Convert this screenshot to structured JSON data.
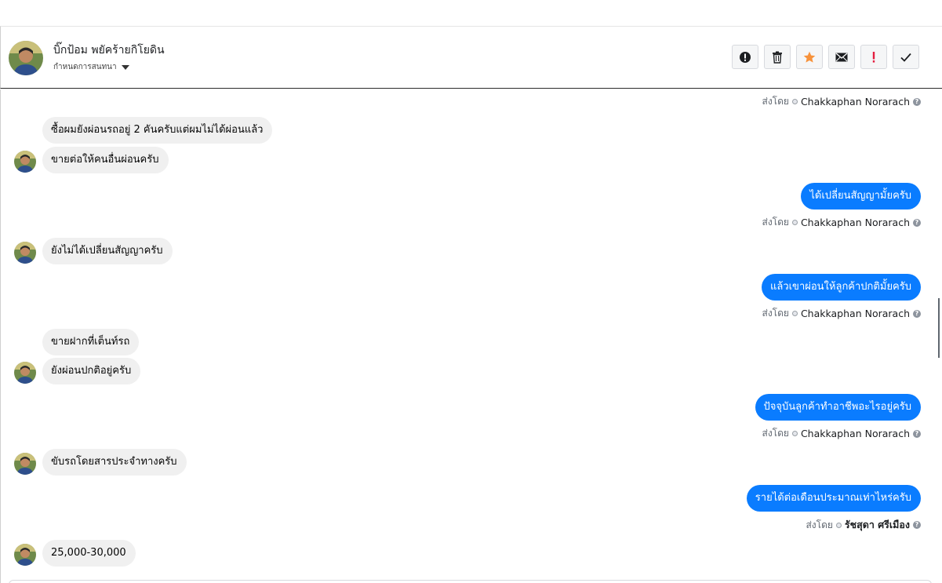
{
  "header": {
    "contact_name": "บิ๊กป้อม พยัคร้ายกิโยดิน",
    "label_dropdown": "กำหนดการสนทนา",
    "toolbar": {
      "report_icon": "exclamation-circle-icon",
      "delete_icon": "trash-icon",
      "star_icon": "star-icon",
      "unread_icon": "envelope-icon",
      "spam_icon": "exclamation-icon",
      "done_icon": "check-icon"
    }
  },
  "colors": {
    "outgoing_bubble": "#0a7cff",
    "incoming_bubble": "#f0f0f0",
    "star": "#f7923b",
    "spam": "#e41e3f"
  },
  "messages": {
    "sent_label": "ส่งโดย",
    "m1_sender": "Chakkaphan Norarach",
    "m2": "ซื้อผมยังผ่อนรถอยู่ 2 คันครับแต่ผมไม่ได้ผ่อนแล้ว",
    "m3": "ขายต่อให้คนอื่นผ่อนครับ",
    "m4": "ได้เปลี่ยนสัญญามั้ยครับ",
    "m4_sender": "Chakkaphan Norarach",
    "m5": "ยังไม่ได้เปลี่ยนสัญญาครับ",
    "m6": "แล้วเขาผ่อนให้ลูกค้าปกติมั้ยครับ",
    "m6_sender": "Chakkaphan Norarach",
    "m7": "ขายฝากที่เต็นท์รถ",
    "m8": "ยังผ่อนปกติอยู่ครับ",
    "m9": "ปัจจุบันลูกค้าทำอาชีพอะไรอยู่ครับ",
    "m9_sender": "Chakkaphan Norarach",
    "m10": "ขับรถโดยสารประจำทางครับ",
    "m11": "รายได้ต่อเดือนประมาณเท่าไหร่ครับ",
    "m11_sender": "รัชสุดา ศรีเมือง",
    "m12": "25,000-30,000"
  }
}
